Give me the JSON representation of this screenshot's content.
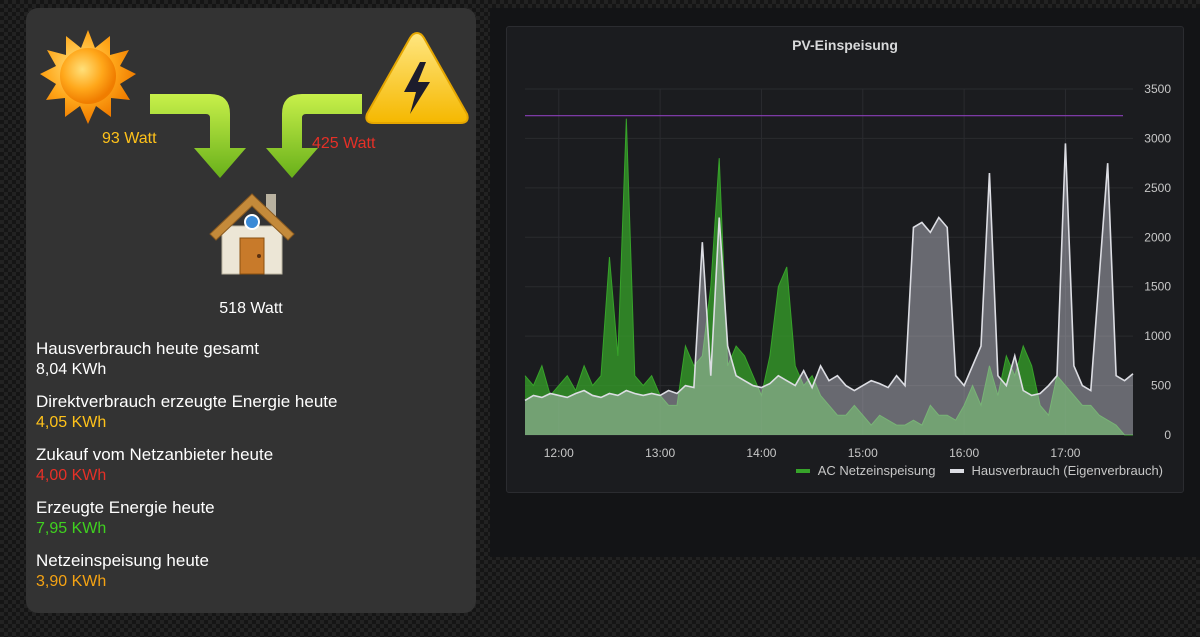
{
  "flow": {
    "solar_watt": "93 Watt",
    "grid_watt": "425 Watt",
    "house_watt": "518 Watt"
  },
  "icons": {
    "solar": "sun-icon",
    "grid": "high-voltage-warning-icon",
    "house": "house-icon",
    "arrows": "arrow-down-icon"
  },
  "colors": {
    "solar": "#ffc21a",
    "grid": "#e63027",
    "produced": "#3fd11f",
    "feed_in": "#f5a313",
    "feed_series": "#37a32a",
    "house_series": "#dcdde3"
  },
  "stats": [
    {
      "label": "Hausverbrauch heute gesamt",
      "value": "8,04 KWh",
      "color": "#ffffff"
    },
    {
      "label": "Direktverbrauch erzeugte Energie heute",
      "value": "4,05 KWh",
      "color": "#ffc21a"
    },
    {
      "label": "Zukauf vom Netzanbieter heute",
      "value": "4,00 KWh",
      "color": "#e63027"
    },
    {
      "label": "Erzeugte Energie heute",
      "value": "7,95 KWh",
      "color": "#3fd11f"
    },
    {
      "label": "Netzeinspeisung heute",
      "value": "3,90 KWh",
      "color": "#f5a313"
    }
  ],
  "chart": {
    "title": "PV-Einspeisung",
    "legend": [
      "AC Netzeinspeisung",
      "Hausverbrauch (Eigenverbrauch)"
    ]
  },
  "chart_data": {
    "type": "area",
    "title": "PV-Einspeisung",
    "x_ticks": [
      "12:00",
      "13:00",
      "14:00",
      "15:00",
      "16:00",
      "17:00"
    ],
    "y_ticks": [
      0,
      500,
      1000,
      1500,
      2000,
      2500,
      3000,
      3500
    ],
    "ylim": [
      0,
      3500
    ],
    "xlim": [
      "11:40",
      "17:40"
    ],
    "threshold_line": 3230,
    "legend_position": "bottom-right",
    "series": [
      {
        "name": "AC Netzeinspeisung",
        "x": [
          "11:40",
          "11:45",
          "11:50",
          "11:55",
          "12:00",
          "12:05",
          "12:10",
          "12:15",
          "12:20",
          "12:25",
          "12:30",
          "12:35",
          "12:40",
          "12:45",
          "12:50",
          "12:55",
          "13:00",
          "13:05",
          "13:10",
          "13:15",
          "13:20",
          "13:25",
          "13:30",
          "13:35",
          "13:40",
          "13:45",
          "13:50",
          "13:55",
          "14:00",
          "14:05",
          "14:10",
          "14:15",
          "14:20",
          "14:25",
          "14:30",
          "14:35",
          "14:40",
          "14:45",
          "14:50",
          "14:55",
          "15:00",
          "15:05",
          "15:10",
          "15:15",
          "15:20",
          "15:25",
          "15:30",
          "15:35",
          "15:40",
          "15:45",
          "15:50",
          "15:55",
          "16:00",
          "16:05",
          "16:10",
          "16:15",
          "16:20",
          "16:25",
          "16:30",
          "16:35",
          "16:40",
          "16:45",
          "16:50",
          "16:55",
          "17:00",
          "17:05",
          "17:10",
          "17:15",
          "17:20",
          "17:25",
          "17:30",
          "17:35",
          "17:40"
        ],
        "values": [
          600,
          500,
          700,
          400,
          500,
          600,
          450,
          700,
          500,
          600,
          1800,
          800,
          3200,
          600,
          500,
          600,
          400,
          300,
          300,
          900,
          700,
          800,
          1500,
          2800,
          700,
          900,
          800,
          600,
          400,
          800,
          1500,
          1700,
          700,
          500,
          600,
          400,
          300,
          200,
          200,
          300,
          200,
          100,
          200,
          150,
          100,
          100,
          150,
          100,
          300,
          200,
          200,
          150,
          300,
          500,
          300,
          700,
          400,
          800,
          600,
          900,
          700,
          300,
          200,
          600,
          500,
          400,
          300,
          300,
          200,
          150,
          100,
          0,
          0
        ]
      },
      {
        "name": "Hausverbrauch (Eigenverbrauch)",
        "x": [
          "11:40",
          "11:45",
          "11:50",
          "11:55",
          "12:00",
          "12:05",
          "12:10",
          "12:15",
          "12:20",
          "12:25",
          "12:30",
          "12:35",
          "12:40",
          "12:45",
          "12:50",
          "12:55",
          "13:00",
          "13:05",
          "13:10",
          "13:15",
          "13:20",
          "13:25",
          "13:30",
          "13:35",
          "13:40",
          "13:45",
          "13:50",
          "13:55",
          "14:00",
          "14:05",
          "14:10",
          "14:15",
          "14:20",
          "14:25",
          "14:30",
          "14:35",
          "14:40",
          "14:45",
          "14:50",
          "14:55",
          "15:00",
          "15:05",
          "15:10",
          "15:15",
          "15:20",
          "15:25",
          "15:30",
          "15:35",
          "15:40",
          "15:45",
          "15:50",
          "15:55",
          "16:00",
          "16:05",
          "16:10",
          "16:15",
          "16:20",
          "16:25",
          "16:30",
          "16:35",
          "16:40",
          "16:45",
          "16:50",
          "16:55",
          "17:00",
          "17:05",
          "17:10",
          "17:15",
          "17:20",
          "17:25",
          "17:30",
          "17:35",
          "17:40"
        ],
        "values": [
          350,
          400,
          380,
          420,
          400,
          380,
          420,
          450,
          400,
          380,
          420,
          400,
          450,
          420,
          400,
          420,
          400,
          450,
          420,
          500,
          480,
          1950,
          600,
          2200,
          900,
          600,
          550,
          500,
          480,
          520,
          600,
          550,
          500,
          650,
          480,
          700,
          550,
          600,
          500,
          450,
          500,
          550,
          520,
          480,
          600,
          500,
          2100,
          2150,
          2050,
          2200,
          2100,
          600,
          500,
          700,
          900,
          2650,
          600,
          500,
          800,
          450,
          400,
          420,
          500,
          600,
          2950,
          700,
          500,
          450,
          1600,
          2750,
          600,
          550,
          620
        ]
      }
    ]
  }
}
